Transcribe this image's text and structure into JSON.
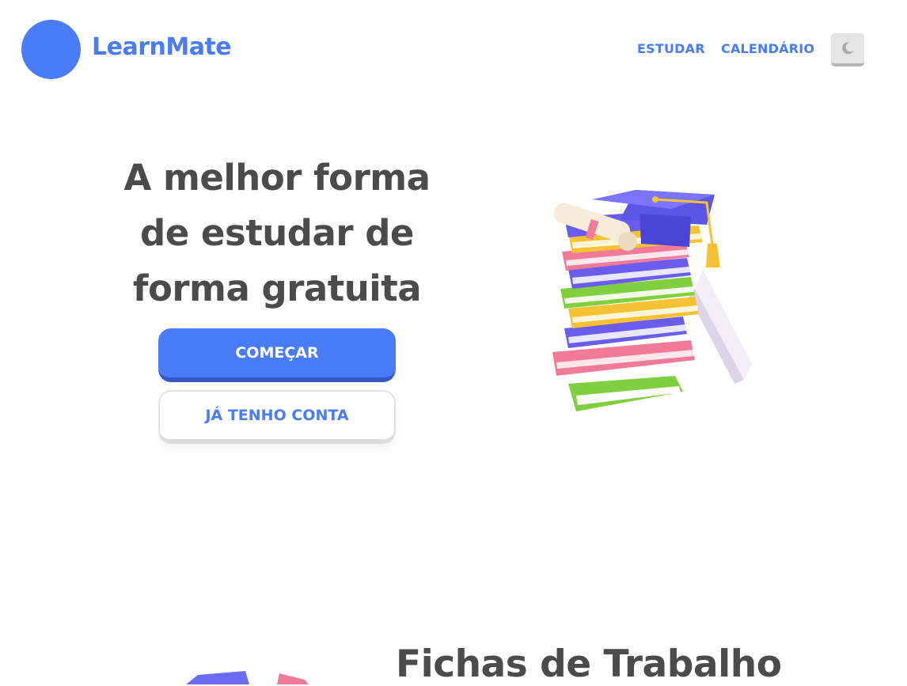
{
  "header": {
    "brand": "LearnMate",
    "nav": [
      {
        "label": "ESTUDAR"
      },
      {
        "label": "CALENDÁRIO"
      }
    ],
    "theme_toggle_icon": "moon-icon"
  },
  "hero": {
    "title_lines": [
      "A melhor forma",
      "de estudar de",
      "forma gratuita"
    ],
    "primary_button": "COMEÇAR",
    "secondary_button": "JÁ TENHO CONTA",
    "illustration": "stacked-books-graduation-cap"
  },
  "section": {
    "title": "Fichas de Trabalho",
    "illustration": "worksheets"
  },
  "colors": {
    "accent": "#4a7cf7",
    "accent_dark": "#3559c4",
    "text": "#4b4b4b"
  }
}
